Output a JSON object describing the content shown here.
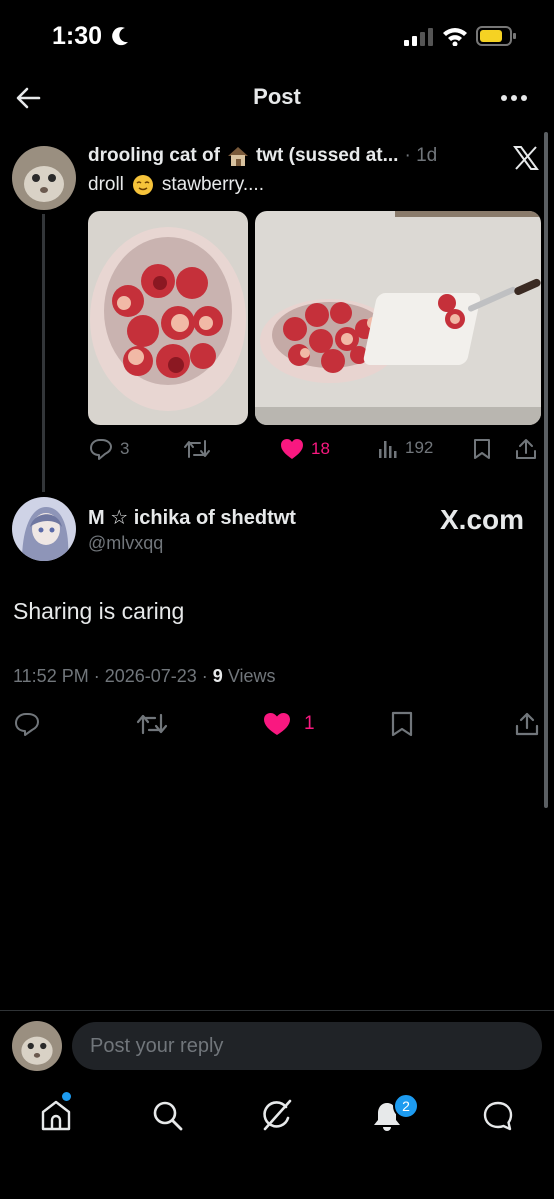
{
  "status_bar": {
    "time": "1:30"
  },
  "header": {
    "title": "Post"
  },
  "quoted_tweet": {
    "author_name": "drooling cat of",
    "author_name_suffix": "twt (sussed at...",
    "time_ago": "· 1d",
    "text_before": "droll",
    "text_after": "stawberry....",
    "replies": "3",
    "likes": "18",
    "views": "192"
  },
  "main_tweet": {
    "author_name": "M ☆ ichika of shedtwt",
    "handle": "@mlvxqq",
    "logo_text": "X.com",
    "body": "Sharing is caring",
    "timestamp": "11:52 PM · 2026-07-23 ·",
    "view_count": "9",
    "views_label": "Views",
    "likes": "1"
  },
  "reply": {
    "placeholder": "Post your reply"
  },
  "nav": {
    "notifications_badge": "2"
  },
  "colors": {
    "like": "#f91880",
    "accent": "#1d9bf0",
    "muted": "#71767b"
  }
}
